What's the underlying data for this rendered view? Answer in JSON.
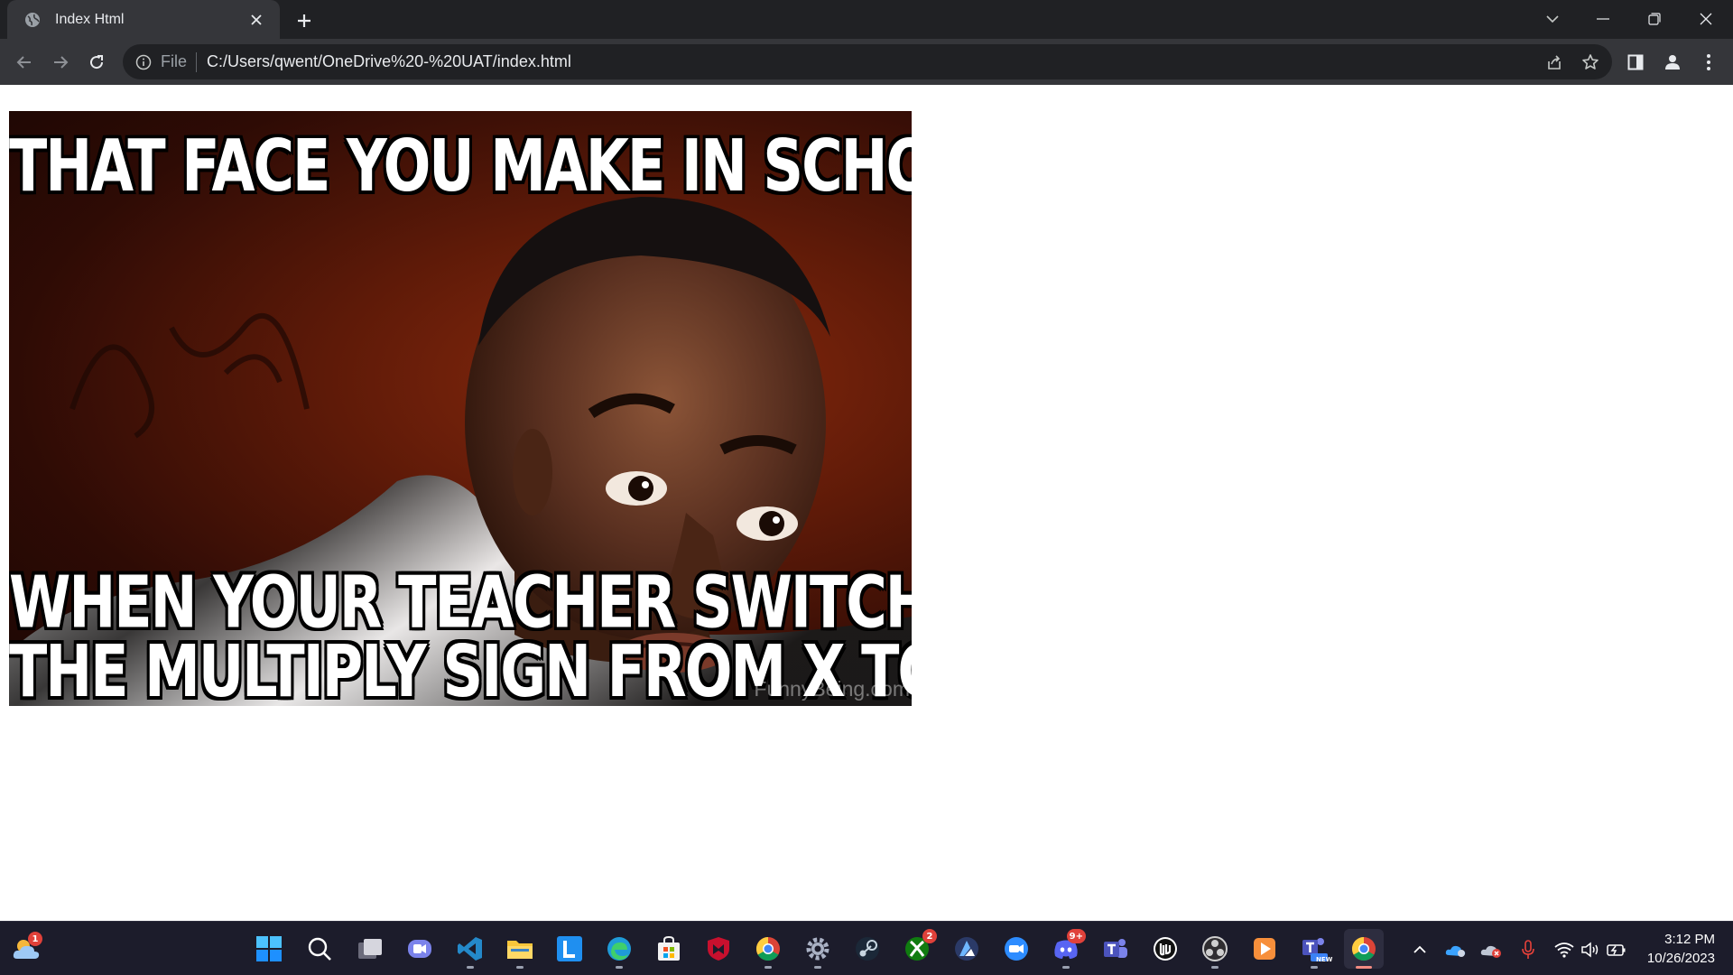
{
  "browser": {
    "tab": {
      "title": "Index Html",
      "favicon": "globe-icon"
    },
    "omnibox": {
      "scheme_label": "File",
      "url": "C:/Users/qwent/OneDrive%20-%20UAT/index.html"
    }
  },
  "meme": {
    "top_caption": "THAT FACE YOU MAKE IN SCHOOL",
    "bottom_caption_line1": "WHEN YOUR TEACHER SWITCHES",
    "bottom_caption_line2": "THE MULTIPLY SIGN FROM X TO •",
    "watermark": "FunnyBeing.com"
  },
  "taskbar": {
    "weather_badge": "1",
    "xbox_badge": "2",
    "discord_badge": "9+",
    "teams_new_label": "NEW"
  },
  "clock": {
    "time": "3:12 PM",
    "date": "10/26/2023"
  },
  "colors": {
    "chrome_dark": "#202124",
    "chrome_toolbar": "#35363a",
    "taskbar": "#1c1c2b",
    "active_indicator": "#f28b82"
  }
}
